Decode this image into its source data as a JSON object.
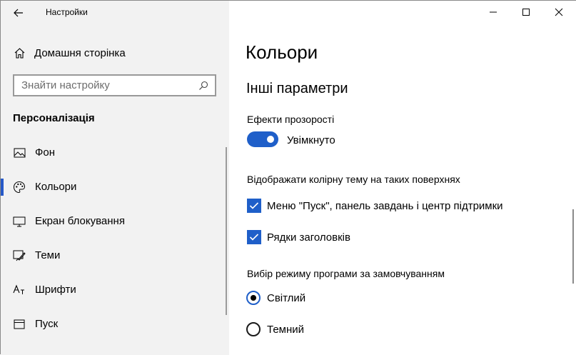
{
  "window": {
    "title": "Настройки"
  },
  "sidebar": {
    "home_label": "Домашня сторінка",
    "search_placeholder": "Знайти настройку",
    "section_title": "Персоналізація",
    "items": [
      {
        "label": "Фон",
        "icon": "picture-icon",
        "active": false
      },
      {
        "label": "Кольори",
        "icon": "palette-icon",
        "active": true
      },
      {
        "label": "Екран блокування",
        "icon": "lock-screen-icon",
        "active": false
      },
      {
        "label": "Теми",
        "icon": "brush-icon",
        "active": false
      },
      {
        "label": "Шрифти",
        "icon": "font-icon",
        "active": false
      },
      {
        "label": "Пуск",
        "icon": "start-icon",
        "active": false
      }
    ]
  },
  "main": {
    "title": "Кольори",
    "subtitle": "Інші параметри",
    "transparency": {
      "label": "Ефекти прозорості",
      "state": "Увімкнуто",
      "on": true
    },
    "surfaces": {
      "label": "Відображати колірну тему на таких поверхнях",
      "options": [
        {
          "label": "Меню \"Пуск\", панель завдань і центр підтримки",
          "checked": true
        },
        {
          "label": "Рядки заголовків",
          "checked": true
        }
      ]
    },
    "app_mode": {
      "label": "Вибір режиму програми за замовчуванням",
      "options": [
        {
          "label": "Світлий",
          "selected": true
        },
        {
          "label": "Темний",
          "selected": false
        }
      ]
    }
  },
  "colors": {
    "accent": "#1f5fc9",
    "sidebar_bg": "#f2f2f2"
  }
}
